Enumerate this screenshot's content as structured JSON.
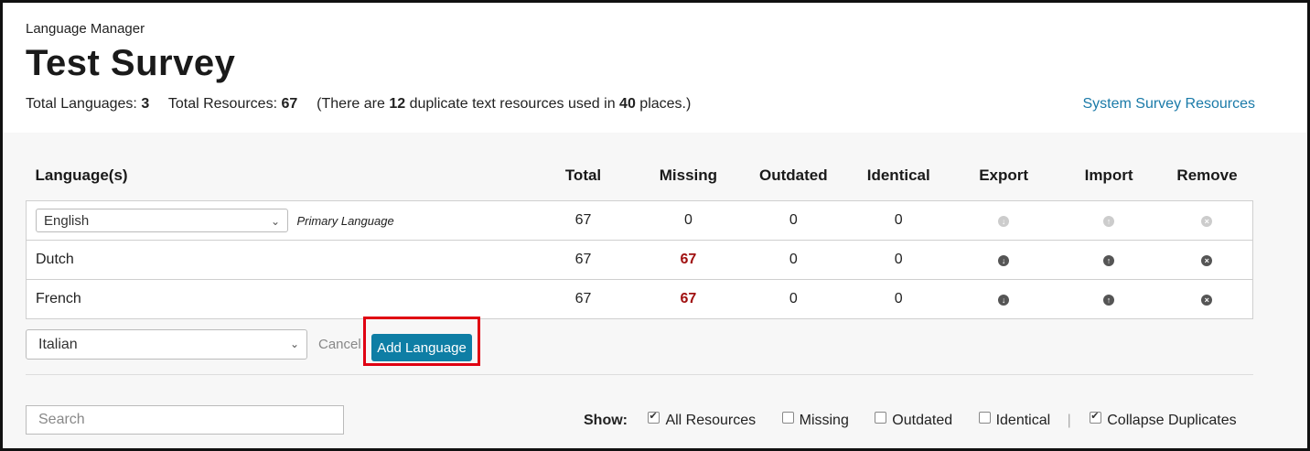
{
  "header": {
    "breadcrumb": "Language Manager",
    "title": "Test Survey",
    "stats": {
      "total_languages_label": "Total Languages:",
      "total_languages_value": "3",
      "total_resources_label": "Total Resources:",
      "total_resources_value": "67",
      "dup_prefix": "(There are",
      "dup_count": "12",
      "dup_middle": "duplicate text resources used in",
      "dup_places": "40",
      "dup_suffix": "places.)"
    },
    "system_resources_link": "System Survey Resources"
  },
  "table": {
    "columns": [
      "Language(s)",
      "Total",
      "Missing",
      "Outdated",
      "Identical",
      "Export",
      "Import",
      "Remove"
    ],
    "rows": [
      {
        "language": "English",
        "primary_label": "Primary Language",
        "total": "67",
        "missing": "0",
        "outdated": "0",
        "identical": "0"
      },
      {
        "language": "Dutch",
        "total": "67",
        "missing": "67",
        "outdated": "0",
        "identical": "0"
      },
      {
        "language": "French",
        "total": "67",
        "missing": "67",
        "outdated": "0",
        "identical": "0"
      }
    ]
  },
  "add_language": {
    "selected": "Italian",
    "cancel_label": "Cancel",
    "button_label": "Add Language"
  },
  "search": {
    "placeholder": "Search"
  },
  "filters": {
    "show_label": "Show:",
    "options": [
      {
        "label": "All Resources",
        "checked": true
      },
      {
        "label": "Missing",
        "checked": false
      },
      {
        "label": "Outdated",
        "checked": false
      },
      {
        "label": "Identical",
        "checked": false
      },
      {
        "label": "Collapse Duplicates",
        "checked": true
      }
    ]
  },
  "icons": {
    "export": "download-circle-icon",
    "import": "upload-circle-icon",
    "remove": "close-circle-icon"
  },
  "colors": {
    "accent": "#0e7ea5",
    "link": "#1a7aa8",
    "missing": "#a01010",
    "highlight": "#e00012"
  }
}
